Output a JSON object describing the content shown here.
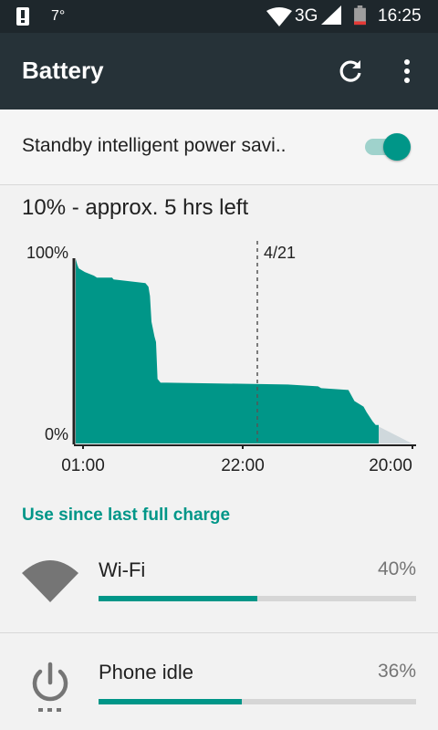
{
  "status_bar": {
    "temperature": "7°",
    "network": "3G",
    "time": "16:25",
    "icons": [
      "alert-icon",
      "wifi-icon",
      "signal-icon",
      "battery-icon"
    ]
  },
  "app_bar": {
    "title": "Battery",
    "actions": [
      "refresh-icon",
      "more-vert-icon"
    ]
  },
  "standby": {
    "label": "Standby intelligent power savi..",
    "enabled": true
  },
  "summary": "10% - approx. 5 hrs left",
  "chart_data": {
    "type": "area",
    "y_tick_labels": [
      "100%",
      "0%"
    ],
    "x_tick_labels": [
      "01:00",
      "22:00",
      "20:00"
    ],
    "marker_label": "4/21",
    "ylim": [
      0,
      100
    ],
    "x_fraction_range": [
      0,
      1
    ],
    "series": [
      {
        "x": [
          0.0,
          0.005,
          0.01,
          0.03,
          0.06,
          0.07,
          0.12,
          0.125,
          0.23,
          0.24,
          0.245,
          0.25,
          0.26,
          0.265,
          0.27,
          0.28,
          0.3,
          0.7,
          0.8,
          0.81,
          0.9,
          0.92,
          0.95,
          0.96,
          0.98,
          0.99,
          1.0
        ],
        "y": [
          100,
          97,
          95,
          93,
          91,
          90,
          90,
          89,
          87,
          85,
          80,
          66,
          58,
          55,
          35,
          33,
          33,
          32,
          31,
          30,
          29,
          23,
          20,
          17,
          12,
          10,
          10
        ]
      }
    ],
    "projection": {
      "x": [
        0.99,
        1.11
      ],
      "y": [
        10,
        0
      ]
    },
    "colors": {
      "fill": "#009688",
      "projection": "#cfd8dc",
      "axis": "#212121",
      "marker": "#555555"
    }
  },
  "section_header": "Use since last full charge",
  "usage": [
    {
      "label": "Wi-Fi",
      "percent": "40%",
      "fraction": 0.5,
      "icon": "wifi-icon"
    },
    {
      "label": "Phone idle",
      "percent": "36%",
      "fraction": 0.45,
      "icon": "power-icon"
    }
  ],
  "colors": {
    "accent": "#009688",
    "app_bar": "#263238",
    "status_bar": "#1e272c"
  }
}
